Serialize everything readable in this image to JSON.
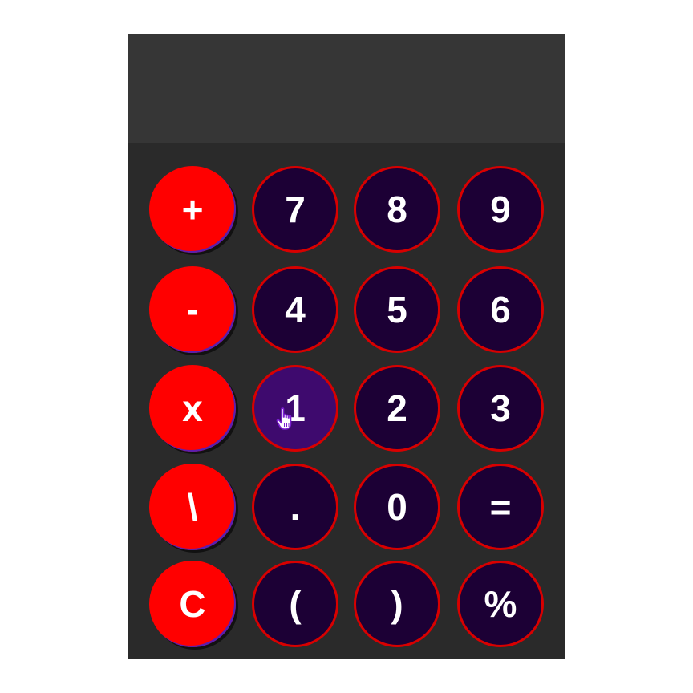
{
  "display": {
    "value": ""
  },
  "keys": {
    "add": "+",
    "seven": "7",
    "eight": "8",
    "nine": "9",
    "subtract": "-",
    "four": "4",
    "five": "5",
    "six": "6",
    "multiply": "x",
    "one": "1",
    "two": "2",
    "three": "3",
    "divide": "\\",
    "decimal": ".",
    "zero": "0",
    "equals": "=",
    "clear": "C",
    "open_paren": "(",
    "close_paren": ")",
    "percent": "%"
  },
  "colors": {
    "operator_key": "#ff0000",
    "number_key": "#1c0035",
    "number_key_hover": "#3e0a6e",
    "number_key_border": "#d80000",
    "body": "#2a2a2a",
    "display": "#363636"
  },
  "hovered_key": "one",
  "pointer_icon": "hand-pointer-icon"
}
